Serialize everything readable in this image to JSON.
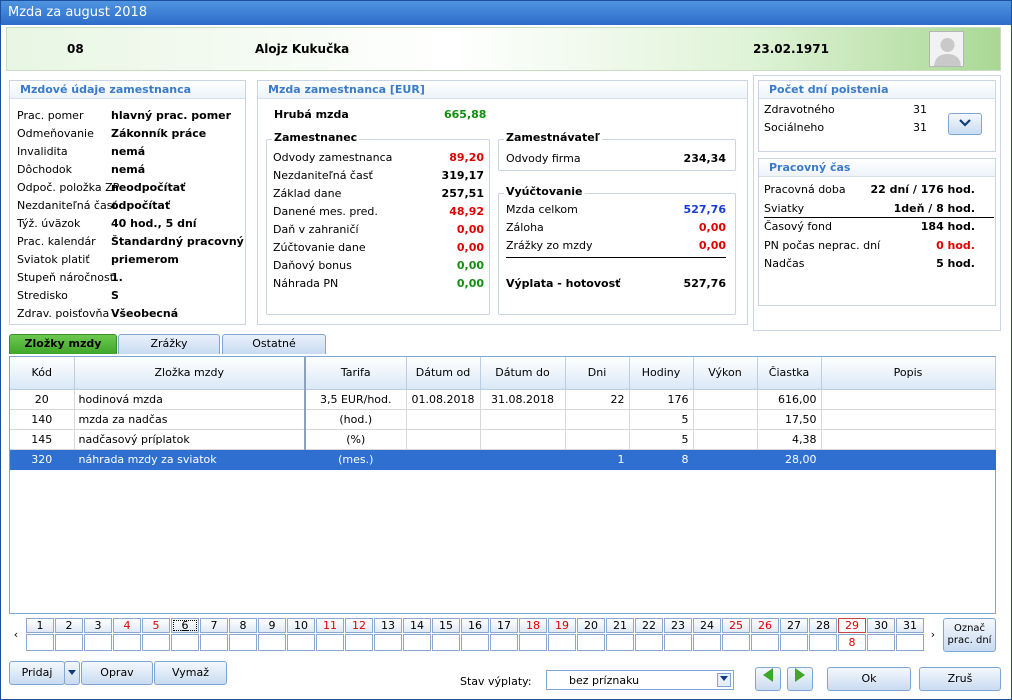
{
  "window": {
    "title": "Mzda za august 2018"
  },
  "header": {
    "id": "08",
    "name": "Alojz Kukučka",
    "date": "23.02.1971"
  },
  "mzdove": {
    "title": "Mzdové údaje zamestnanca",
    "rows": [
      {
        "label": "Prac. pomer",
        "value": "hlavný prac. pomer"
      },
      {
        "label": "Odmeňovanie",
        "value": "Zákonník práce"
      },
      {
        "label": "Invalidita",
        "value": "nemá"
      },
      {
        "label": "Dôchodok",
        "value": "nemá"
      },
      {
        "label": "Odpoč. položka ZP",
        "value": "neodpočítať"
      },
      {
        "label": "Nezdaniteľná časť",
        "value": "odpočítať"
      },
      {
        "label": "Týž. úväzok",
        "value": "40 hod., 5 dní"
      },
      {
        "label": "Prac. kalendár",
        "value": "Štandardný pracovný"
      },
      {
        "label": "Sviatok platiť",
        "value": "priemerom"
      },
      {
        "label": "Stupeň náročnosti",
        "value": "1."
      },
      {
        "label": "Stredisko",
        "value": "S"
      },
      {
        "label": "Zdrav. poisťovňa",
        "value": "Všeobecná"
      }
    ]
  },
  "mzda": {
    "title": "Mzda zamestnanca [EUR]",
    "hruba_label": "Hrubá mzda",
    "hruba_value": "665,88",
    "zamestnanec_title": "Zamestnanec",
    "zamestnanec": [
      {
        "label": "Odvody zamestnanca",
        "value": "89,20"
      },
      {
        "label": "Nezdaniteľná časť",
        "value": "319,17"
      },
      {
        "label": "Základ dane",
        "value": "257,51"
      },
      {
        "label": "Danené mes. pred.",
        "value": "48,92"
      },
      {
        "label": "Daň v zahraničí",
        "value": "0,00"
      },
      {
        "label": "Zúčtovanie dane",
        "value": "0,00"
      },
      {
        "label": "Daňový bonus",
        "value": "0,00"
      },
      {
        "label": "Náhrada PN",
        "value": "0,00"
      }
    ],
    "zamestnavatel_title": "Zamestnávateľ",
    "odvody_firma_label": "Odvody firma",
    "odvody_firma_value": "234,34",
    "vyuctovanie_title": "Vyúčtovanie",
    "vyuctovanie": [
      {
        "label": "Mzda celkom",
        "value": "527,76"
      },
      {
        "label": "Záloha",
        "value": "0,00"
      },
      {
        "label": "Zrážky zo mzdy",
        "value": "0,00"
      }
    ],
    "vyplata_label": "Výplata - hotovosť",
    "vyplata_value": "527,76"
  },
  "poistenia": {
    "title": "Počet dní poistenia",
    "rows": [
      {
        "label": "Zdravotného",
        "value": "31"
      },
      {
        "label": "Sociálneho",
        "value": "31"
      }
    ]
  },
  "pracovny": {
    "title": "Pracovný čas",
    "rows": [
      {
        "label": "Pracovná doba",
        "value": "22 dní / 176 hod."
      },
      {
        "label": "Sviatky",
        "value": "1deň / 8 hod."
      },
      {
        "label": "Časový fond",
        "value": "184 hod."
      },
      {
        "label": "PN počas neprac. dní",
        "value": "0 hod."
      },
      {
        "label": "Nadčas",
        "value": "5 hod."
      }
    ]
  },
  "tabs": [
    "Zložky mzdy",
    "Zrážky",
    "Ostatné"
  ],
  "table": {
    "columns": [
      "Kód",
      "Zložka mzdy",
      "Tarifa",
      "Dátum od",
      "Dátum do",
      "Dni",
      "Hodiny",
      "Výkon",
      "Čiastka",
      "Popis"
    ],
    "rows": [
      [
        "20",
        "hodinová mzda",
        "3,5 EUR/hod.",
        "01.08.2018",
        "31.08.2018",
        "22",
        "176",
        "",
        "616,00",
        ""
      ],
      [
        "140",
        "mzda za nadčas",
        "(hod.)",
        "",
        "",
        "",
        "5",
        "",
        "17,50",
        ""
      ],
      [
        "145",
        "nadčasový príplatok",
        "(%)",
        "",
        "",
        "",
        "5",
        "",
        "4,38",
        ""
      ],
      [
        "320",
        "náhrada mzdy za sviatok",
        "(mes.)",
        "",
        "",
        "1",
        "8",
        "",
        "28,00",
        ""
      ]
    ]
  },
  "days": {
    "labels": [
      "1",
      "2",
      "3",
      "4",
      "5",
      "6",
      "7",
      "8",
      "9",
      "10",
      "11",
      "12",
      "13",
      "14",
      "15",
      "16",
      "17",
      "18",
      "19",
      "20",
      "21",
      "22",
      "23",
      "24",
      "25",
      "26",
      "27",
      "28",
      "29",
      "30",
      "31"
    ],
    "weekend": [
      "4",
      "5",
      "11",
      "12",
      "18",
      "19",
      "25",
      "26"
    ],
    "holiday": [
      "29"
    ],
    "holiday_value": "8",
    "prev": "‹",
    "next": "›",
    "mark_btn_1": "Označ",
    "mark_btn_2": "prac. dní"
  },
  "bottom": {
    "pridaj": "Pridaj",
    "oprav": "Oprav",
    "vymaz": "Vymaž",
    "stav_label": "Stav výplaty:",
    "stav_value": "bez príznaku",
    "ok": "Ok",
    "zrus": "Zruš"
  }
}
